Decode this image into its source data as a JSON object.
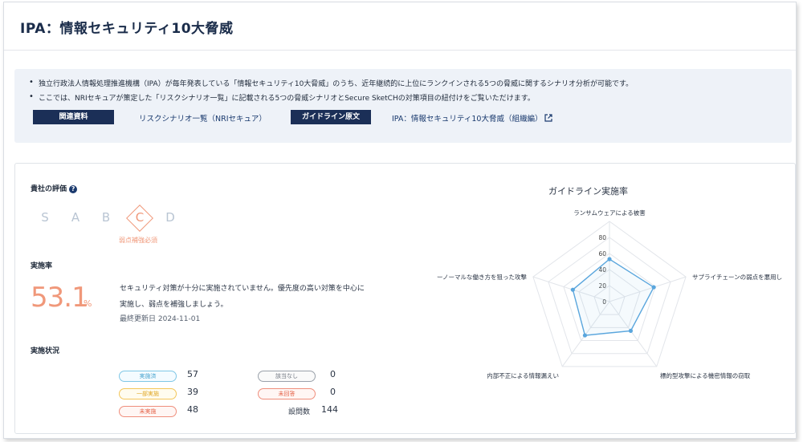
{
  "page_title": "IPA：情報セキュリティ10大脅威",
  "info": {
    "bullet": "•",
    "line1": "独立行政法人情報処理推進機構（IPA）が毎年発表している「情報セキュリティ10大脅威」のうち、近年継続的に上位にランクインされる5つの脅威に関するシナリオ分析が可能です。",
    "line2": "ここでは、NRIセキュアが策定した「リスクシナリオ一覧」に記載される5つの脅威シナリオとSecure SketCHの対策項目の紐付けをご覧いただけます。",
    "tag_related": "関連資料",
    "link_related": "リスクシナリオ一覧（NRIセキュア）",
    "tag_guideline": "ガイドライン原文",
    "link_guideline": "IPA：情報セキュリティ10大脅威（組織編）"
  },
  "evaluation": {
    "label": "貴社の評価",
    "help": "?",
    "grades": [
      "S",
      "A",
      "B",
      "C",
      "D"
    ],
    "selected": "C",
    "note": "弱点補強必須"
  },
  "rate": {
    "label": "実施率",
    "value": "53.1",
    "unit": "%",
    "message_line1": "セキュリティ対策が十分に実施されていません。優先度の高い対策を中心に",
    "message_line2": "実施し、弱点を補強しましょう。",
    "updated": "最終更新日 2024-11-01"
  },
  "status": {
    "label": "実施状況",
    "items": [
      {
        "label": "実施済",
        "count": "57"
      },
      {
        "label": "一部実施",
        "count": "39"
      },
      {
        "label": "未実施",
        "count": "48"
      },
      {
        "label": "該当なし",
        "count": "0"
      },
      {
        "label": "未回答",
        "count": "0"
      }
    ],
    "questions_label": "設問数",
    "questions_count": "144"
  },
  "colors": {
    "accent": "#f0987a",
    "navy": "#1b2f57",
    "series": "#5aa6dd"
  },
  "chart_data": {
    "type": "radar",
    "title": "ガイドライン実施率",
    "axes": [
      "ランサムウェアによる被害",
      "サプライチェーンの弱点を悪用し",
      "標的型攻撃による機密情報の窃取",
      "内部不正による情報漏えい",
      "ーノーマルな働き方を狙った攻撃"
    ],
    "ticks": [
      0,
      20,
      40,
      60,
      80
    ],
    "range": [
      0,
      100
    ],
    "series": [
      {
        "values": [
          53,
          58,
          45,
          52,
          48
        ]
      }
    ]
  }
}
